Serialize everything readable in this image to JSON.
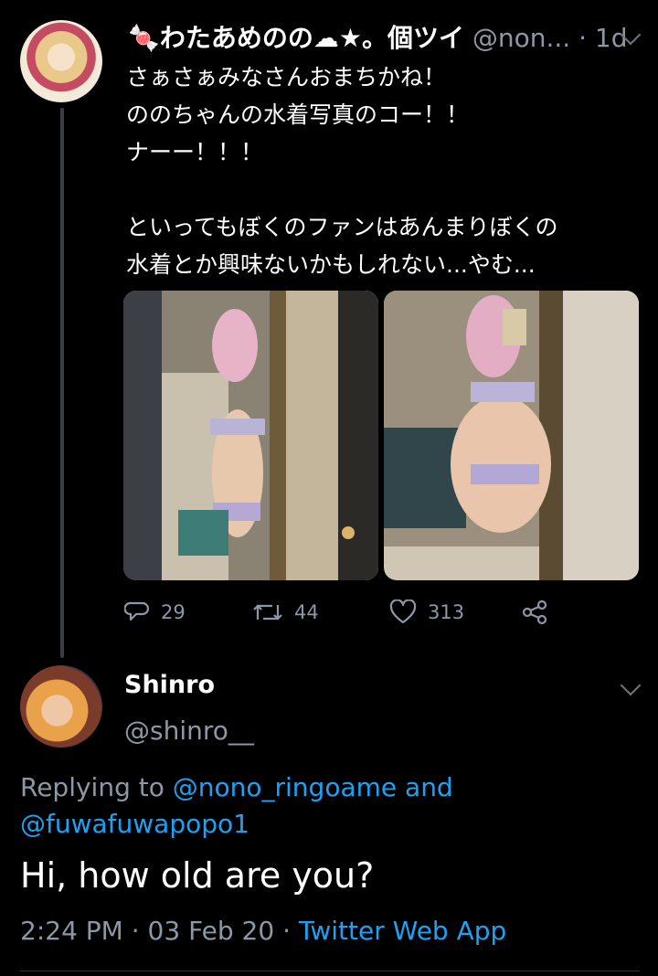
{
  "tweet": {
    "display_name": "🍬わたあめのの☁★。個ツイ",
    "handle": "@non...",
    "separator": "·",
    "time": "1d",
    "text": "さぁさぁみなさんおまちかね！\nののちゃんの水着写真のコー！！\nナーー！！！\n\nといってもぼくのファンはあんまりぼくの\n水着とか興味ないかもしれない...やむ...",
    "stats": {
      "replies": "29",
      "retweets": "44",
      "likes": "313"
    }
  },
  "reply": {
    "display_name": "Shinro",
    "handle": "@shinro__",
    "replying_prefix": "Replying to",
    "replying_user_1": "@nono_ringoame",
    "replying_and": "and",
    "replying_user_2": "@fuwafuwapopo1",
    "text": "Hi, how old are you?",
    "time": "2:24 PM",
    "date": "03 Feb 20",
    "app": "Twitter Web App"
  },
  "icons": [
    "chevron-down-icon",
    "reply-icon",
    "retweet-icon",
    "like-icon",
    "share-icon"
  ],
  "colors": {
    "background": "#000000",
    "secondary_text": "#8b98a5",
    "link": "#1da1f2",
    "thread_line": "#3a3f44"
  }
}
